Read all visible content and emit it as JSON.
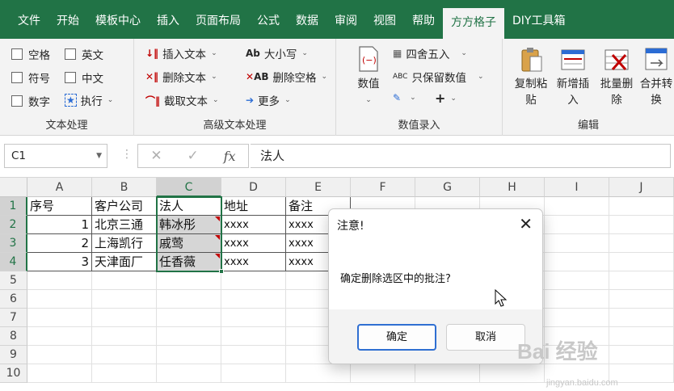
{
  "tabs": [
    "文件",
    "开始",
    "模板中心",
    "插入",
    "页面布局",
    "公式",
    "数据",
    "审阅",
    "视图",
    "帮助",
    "方方格子",
    "DIY工具箱"
  ],
  "active_tab": "方方格子",
  "ribbon": {
    "text_group": {
      "label": "文本处理",
      "checkboxes": [
        "空格",
        "英文",
        "符号",
        "中文",
        "数字"
      ],
      "exec_label": "执行"
    },
    "adv_group": {
      "label": "高级文本处理",
      "insert_text": "插入文本",
      "delete_text": "删除文本",
      "extract_text": "截取文本",
      "case": "大小写",
      "delete_space": "删除空格",
      "more": "更多"
    },
    "value_group": {
      "label": "数值录入",
      "value_btn": "数值",
      "round": "四舍五入",
      "keep_value": "只保留数值",
      "plus": "+"
    },
    "edit_group": {
      "label": "编辑",
      "copy_paste": [
        "复制粘",
        "贴"
      ],
      "add_insert": [
        "新增插",
        "入"
      ],
      "batch_delete": [
        "批量删",
        "除"
      ],
      "merge_convert": [
        "合并转",
        "换"
      ]
    }
  },
  "formula_bar": {
    "name_box": "C1",
    "cancel": "✕",
    "confirm": "✓",
    "fx": "fx",
    "content": "法人"
  },
  "columns": [
    "A",
    "B",
    "C",
    "D",
    "E",
    "F",
    "G",
    "H",
    "I",
    "J"
  ],
  "rows": [
    "1",
    "2",
    "3",
    "4",
    "5",
    "6",
    "7",
    "8",
    "9",
    "10"
  ],
  "cells": {
    "A1": "序号",
    "B1": "客户公司",
    "C1": "法人",
    "D1": "地址",
    "E1": "备注",
    "A2": "1",
    "B2": "北京三通",
    "C2": "韩冰彤",
    "D2": "xxxx",
    "E2": "xxxx",
    "A3": "2",
    "B3": "上海凯行",
    "C3": "戚莺",
    "D3": "xxxx",
    "E3": "xxxx",
    "A4": "3",
    "B4": "天津面厂",
    "C4": "任香薇",
    "D4": "xxxx",
    "E4": "xxxx"
  },
  "dialog": {
    "title": "注意!",
    "message": "确定删除选区中的批注?",
    "ok": "确定",
    "cancel": "取消"
  },
  "watermark": {
    "main": "Bai 经验",
    "sub": "jingyan.baidu.com"
  },
  "colors": {
    "excel_green": "#217346",
    "comment_red": "#c00000",
    "primary_border": "#2f6fd2"
  }
}
